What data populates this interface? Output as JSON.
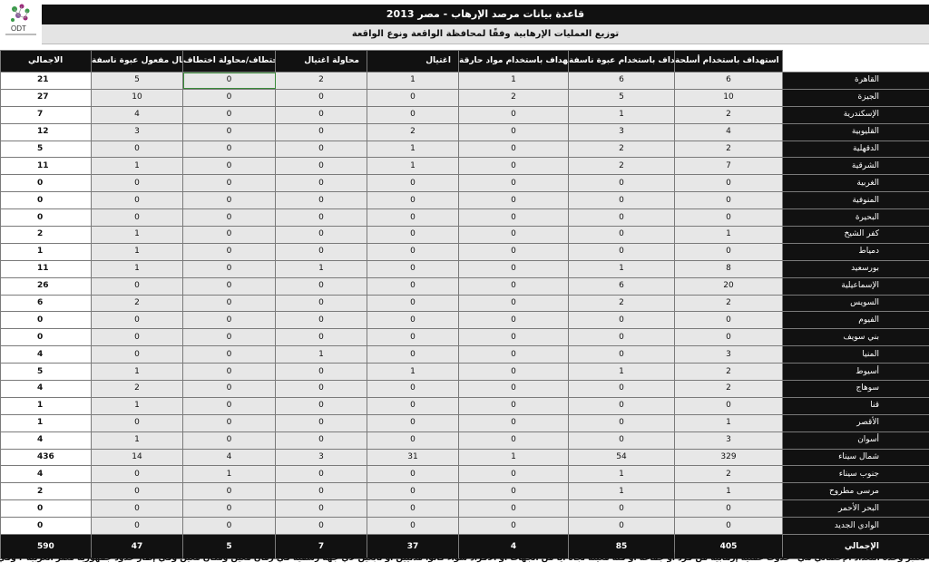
{
  "logo": {
    "text": "ODT"
  },
  "title": "قاعدة بيانات مرصد الإرهاب - مصر 2013",
  "subtitle": "توزيع العمليات الإرهابية وفقًا لمحافظة الواقعة ونوع الواقعة",
  "columns": [
    "الاجمالي",
    "إبطال مفعول عبوة ناسفة",
    "اختطاف/محاولة اختطاف",
    "محاولة اغتيال",
    "اغتيال",
    "استهداف باستخدام مواد حارقة",
    "استهداف باستخدام عبوة ناسفة",
    "استهداف باستخدام أسلحة"
  ],
  "rows": [
    {
      "gov": "القاهرة",
      "cells": [
        "21",
        "5",
        "0",
        "2",
        "1",
        "1",
        "6",
        "6"
      ]
    },
    {
      "gov": "الجيزة",
      "cells": [
        "27",
        "10",
        "0",
        "0",
        "0",
        "2",
        "5",
        "10"
      ]
    },
    {
      "gov": "الإسكندرية",
      "cells": [
        "7",
        "4",
        "0",
        "0",
        "0",
        "0",
        "1",
        "2"
      ]
    },
    {
      "gov": "القليوبية",
      "cells": [
        "12",
        "3",
        "0",
        "0",
        "2",
        "0",
        "3",
        "4"
      ]
    },
    {
      "gov": "الدقهلية",
      "cells": [
        "5",
        "0",
        "0",
        "0",
        "1",
        "0",
        "2",
        "2"
      ]
    },
    {
      "gov": "الشرقية",
      "cells": [
        "11",
        "1",
        "0",
        "0",
        "1",
        "0",
        "2",
        "7"
      ]
    },
    {
      "gov": "الغربية",
      "cells": [
        "0",
        "0",
        "0",
        "0",
        "0",
        "0",
        "0",
        "0"
      ]
    },
    {
      "gov": "المنوفية",
      "cells": [
        "0",
        "0",
        "0",
        "0",
        "0",
        "0",
        "0",
        "0"
      ]
    },
    {
      "gov": "البحيرة",
      "cells": [
        "0",
        "0",
        "0",
        "0",
        "0",
        "0",
        "0",
        "0"
      ]
    },
    {
      "gov": "كفر الشيخ",
      "cells": [
        "2",
        "1",
        "0",
        "0",
        "0",
        "0",
        "0",
        "1"
      ]
    },
    {
      "gov": "دمياط",
      "cells": [
        "1",
        "1",
        "0",
        "0",
        "0",
        "0",
        "0",
        "0"
      ]
    },
    {
      "gov": "بورسعيد",
      "cells": [
        "11",
        "1",
        "0",
        "1",
        "0",
        "0",
        "1",
        "8"
      ]
    },
    {
      "gov": "الإسماعيلية",
      "cells": [
        "26",
        "0",
        "0",
        "0",
        "0",
        "0",
        "6",
        "20"
      ]
    },
    {
      "gov": "السويس",
      "cells": [
        "6",
        "2",
        "0",
        "0",
        "0",
        "0",
        "2",
        "2"
      ]
    },
    {
      "gov": "الفيوم",
      "cells": [
        "0",
        "0",
        "0",
        "0",
        "0",
        "0",
        "0",
        "0"
      ]
    },
    {
      "gov": "بني سويف",
      "cells": [
        "0",
        "0",
        "0",
        "0",
        "0",
        "0",
        "0",
        "0"
      ]
    },
    {
      "gov": "المنيا",
      "cells": [
        "4",
        "0",
        "0",
        "1",
        "0",
        "0",
        "0",
        "3"
      ]
    },
    {
      "gov": "أسيوط",
      "cells": [
        "5",
        "1",
        "0",
        "0",
        "1",
        "0",
        "1",
        "2"
      ]
    },
    {
      "gov": "سوهاج",
      "cells": [
        "4",
        "2",
        "0",
        "0",
        "0",
        "0",
        "0",
        "2"
      ]
    },
    {
      "gov": "قنا",
      "cells": [
        "1",
        "1",
        "0",
        "0",
        "0",
        "0",
        "0",
        "0"
      ]
    },
    {
      "gov": "الأقصر",
      "cells": [
        "1",
        "0",
        "0",
        "0",
        "0",
        "0",
        "0",
        "1"
      ]
    },
    {
      "gov": "أسوان",
      "cells": [
        "4",
        "1",
        "0",
        "0",
        "0",
        "0",
        "0",
        "3"
      ]
    },
    {
      "gov": "شمال سيناء",
      "cells": [
        "436",
        "14",
        "4",
        "3",
        "31",
        "1",
        "54",
        "329"
      ]
    },
    {
      "gov": "جنوب سيناء",
      "cells": [
        "4",
        "0",
        "1",
        "0",
        "0",
        "0",
        "1",
        "2"
      ]
    },
    {
      "gov": "مرسى مطروح",
      "cells": [
        "2",
        "0",
        "0",
        "0",
        "0",
        "0",
        "1",
        "1"
      ]
    },
    {
      "gov": "البحر الأحمر",
      "cells": [
        "0",
        "0",
        "0",
        "0",
        "0",
        "0",
        "0",
        "0"
      ]
    },
    {
      "gov": "الوادي الجديد",
      "cells": [
        "0",
        "0",
        "0",
        "0",
        "0",
        "0",
        "0",
        "0"
      ]
    }
  ],
  "grand_total": {
    "gov": "الإجمالي",
    "cells": [
      "590",
      "47",
      "5",
      "7",
      "37",
      "4",
      "85",
      "405"
    ]
  },
  "footnote": "تعتبر وحدة التعداد الإحصائي هي \"حدوث عملية إرهابية من فرد أو جماعة أو فئة معينة تجاه أيًا من الجهات أو الأفراد سواء كانوا مدنيين أو تابعين لأي جهة رسمية في زمان معين ومكان معين وفي إطار حدود جمهورية مصر العربية\"، وفي حالة تغير أيًا من المتغيرين السابقين تُحسب كواقعة جديدة."
}
